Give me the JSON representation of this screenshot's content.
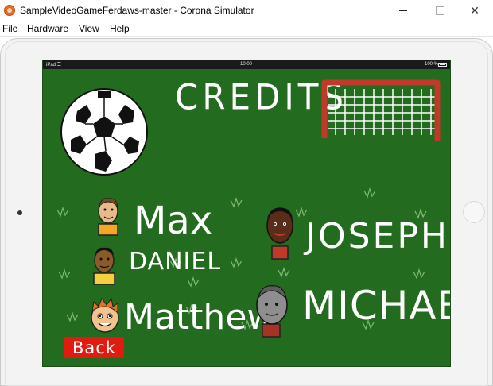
{
  "window": {
    "title": "SampleVideoGameFerdaws-master - Corona Simulator",
    "close_glyph": "✕"
  },
  "menu": [
    "File",
    "Hardware",
    "View",
    "Help"
  ],
  "statusbar": {
    "device": "iPad ☰",
    "time": "10:00",
    "battery": "100 %"
  },
  "screen": {
    "title": "CREDITS",
    "names": {
      "max": "Max",
      "daniel": "DANIEL",
      "matthew": "Matthew",
      "joseph": "JOSEPH",
      "michael": "MICHAEL"
    },
    "back_label": "Back"
  },
  "colors": {
    "field_green": "#236b1f",
    "back_red": "#e01b10",
    "goal_red": "#c0392b"
  }
}
